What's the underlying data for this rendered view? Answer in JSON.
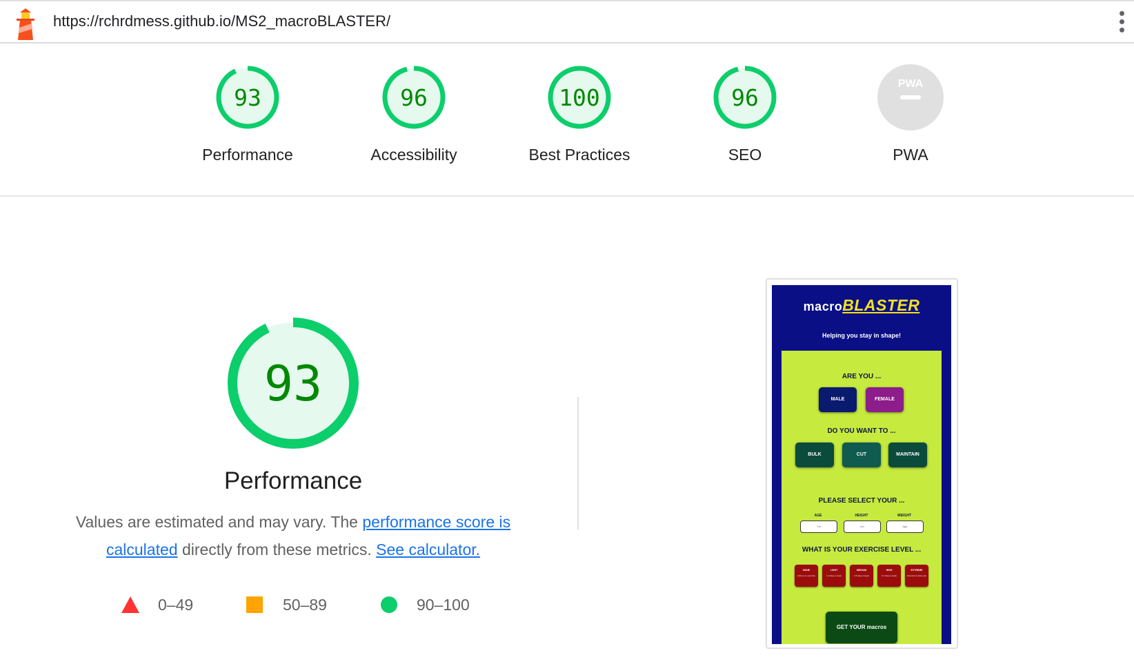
{
  "topbar": {
    "url": "https://rchrdmess.github.io/MS2_macroBLASTER/"
  },
  "colors": {
    "pass_green": "#0cce6b",
    "pass_green_text": "#008800",
    "pass_fill": "#e5f9ee",
    "na_gray": "#e0e0e0",
    "fail_red": "#ff3333",
    "average_orange": "#ffa400",
    "link_blue": "#1a73e8"
  },
  "gauges": [
    {
      "label": "Performance",
      "score": "93",
      "value": 0.93
    },
    {
      "label": "Accessibility",
      "score": "96",
      "value": 0.96
    },
    {
      "label": "Best Practices",
      "score": "100",
      "value": 1.0
    },
    {
      "label": "SEO",
      "score": "96",
      "value": 0.96
    },
    {
      "label": "PWA",
      "score": "",
      "icon": "pwa-icon",
      "pwa_text": "PWA"
    }
  ],
  "performance": {
    "score": "93",
    "value": 0.93,
    "title": "Performance",
    "desc_prefix": "Values are estimated and may vary. The ",
    "link1": "performance score is calculated",
    "desc_mid": " directly from these metrics. ",
    "link2": "See calculator."
  },
  "legend": [
    {
      "icon": "triangle-fail-icon",
      "range": "0–49"
    },
    {
      "icon": "square-average-icon",
      "range": "50–89"
    },
    {
      "icon": "circle-pass-icon",
      "range": "90–100"
    }
  ],
  "screenshot": {
    "brand_macro": "macro",
    "brand_blaster": "BLASTER",
    "tagline": "Helping you stay in shape!",
    "q1": "ARE YOU ...",
    "male": "MALE",
    "female": "FEMALE",
    "q2": "DO YOU WANT TO ...",
    "bulk": "BULK",
    "cut": "CUT",
    "maintain": "MAINTAIN",
    "q3": "PLEASE SELECT YOUR ...",
    "age": "AGE",
    "height": "HEIGHT",
    "weight": "WEIGHT",
    "age_ph": "Yrs",
    "height_ph": "cm",
    "weight_ph": "kgs",
    "q4": "WHAT IS YOUR EXERCISE LEVEL ...",
    "ex": [
      {
        "t": "NONE",
        "s": "Little to no exercise"
      },
      {
        "t": "LIGHT",
        "s": "1-2 days a week"
      },
      {
        "t": "MEDIUM",
        "s": "3-5 days a week"
      },
      {
        "t": "HIGH",
        "s": "6-7 days a week"
      },
      {
        "t": "EXTREME",
        "s": "Exercise & active job"
      }
    ],
    "cta": "GET YOUR macros"
  }
}
